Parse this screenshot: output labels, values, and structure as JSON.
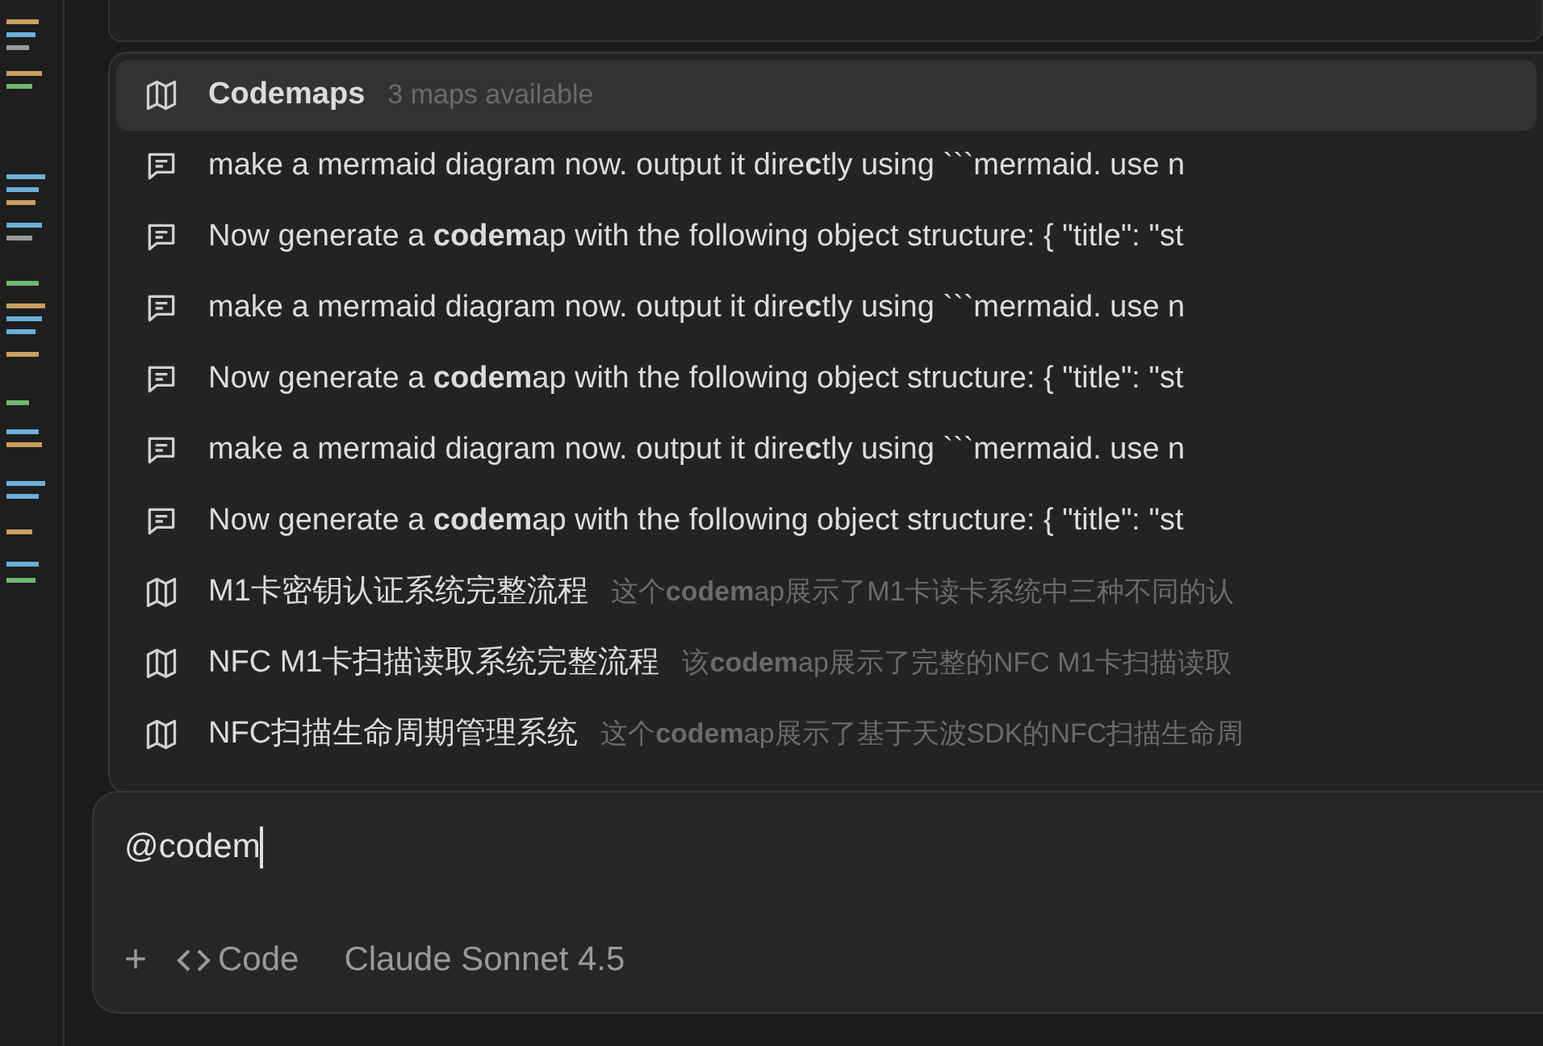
{
  "menu": {
    "items": [
      {
        "kind": "codemap",
        "title": "**Codem**aps",
        "description": "3 maps available",
        "selected": true
      },
      {
        "kind": "chat",
        "title": "make a mermaid diagram now. output it dire**c**tly using ```mermaid. use n",
        "selected": false
      },
      {
        "kind": "chat",
        "title": "Now generate a **codem**ap with the following object structure: { \"title\": \"st",
        "selected": false
      },
      {
        "kind": "chat",
        "title": "make a mermaid diagram now. output it dire**c**tly using ```mermaid. use n",
        "selected": false
      },
      {
        "kind": "chat",
        "title": "Now generate a **codem**ap with the following object structure: { \"title\": \"st",
        "selected": false
      },
      {
        "kind": "chat",
        "title": "make a mermaid diagram now. output it dire**c**tly using ```mermaid. use n",
        "selected": false
      },
      {
        "kind": "chat",
        "title": "Now generate a **codem**ap with the following object structure: { \"title\": \"st",
        "selected": false
      },
      {
        "kind": "codemap",
        "title": "M1卡密钥认证系统完整流程",
        "description": "这个**codem**ap展示了M1卡读卡系统中三种不同的认",
        "selected": false
      },
      {
        "kind": "codemap",
        "title": "NFC M1卡扫描读取系统完整流程",
        "description": "该**codem**ap展示了完整的NFC M1卡扫描读取",
        "selected": false
      },
      {
        "kind": "codemap",
        "title": "NFC扫描生命周期管理系统",
        "description": "这个**codem**ap展示了基于天波SDK的NFC扫描生命周",
        "selected": false
      }
    ]
  },
  "input": {
    "value": "@codem"
  },
  "toolbar": {
    "add": "+",
    "mode": "Code",
    "model": "Claude Sonnet 4.5"
  }
}
